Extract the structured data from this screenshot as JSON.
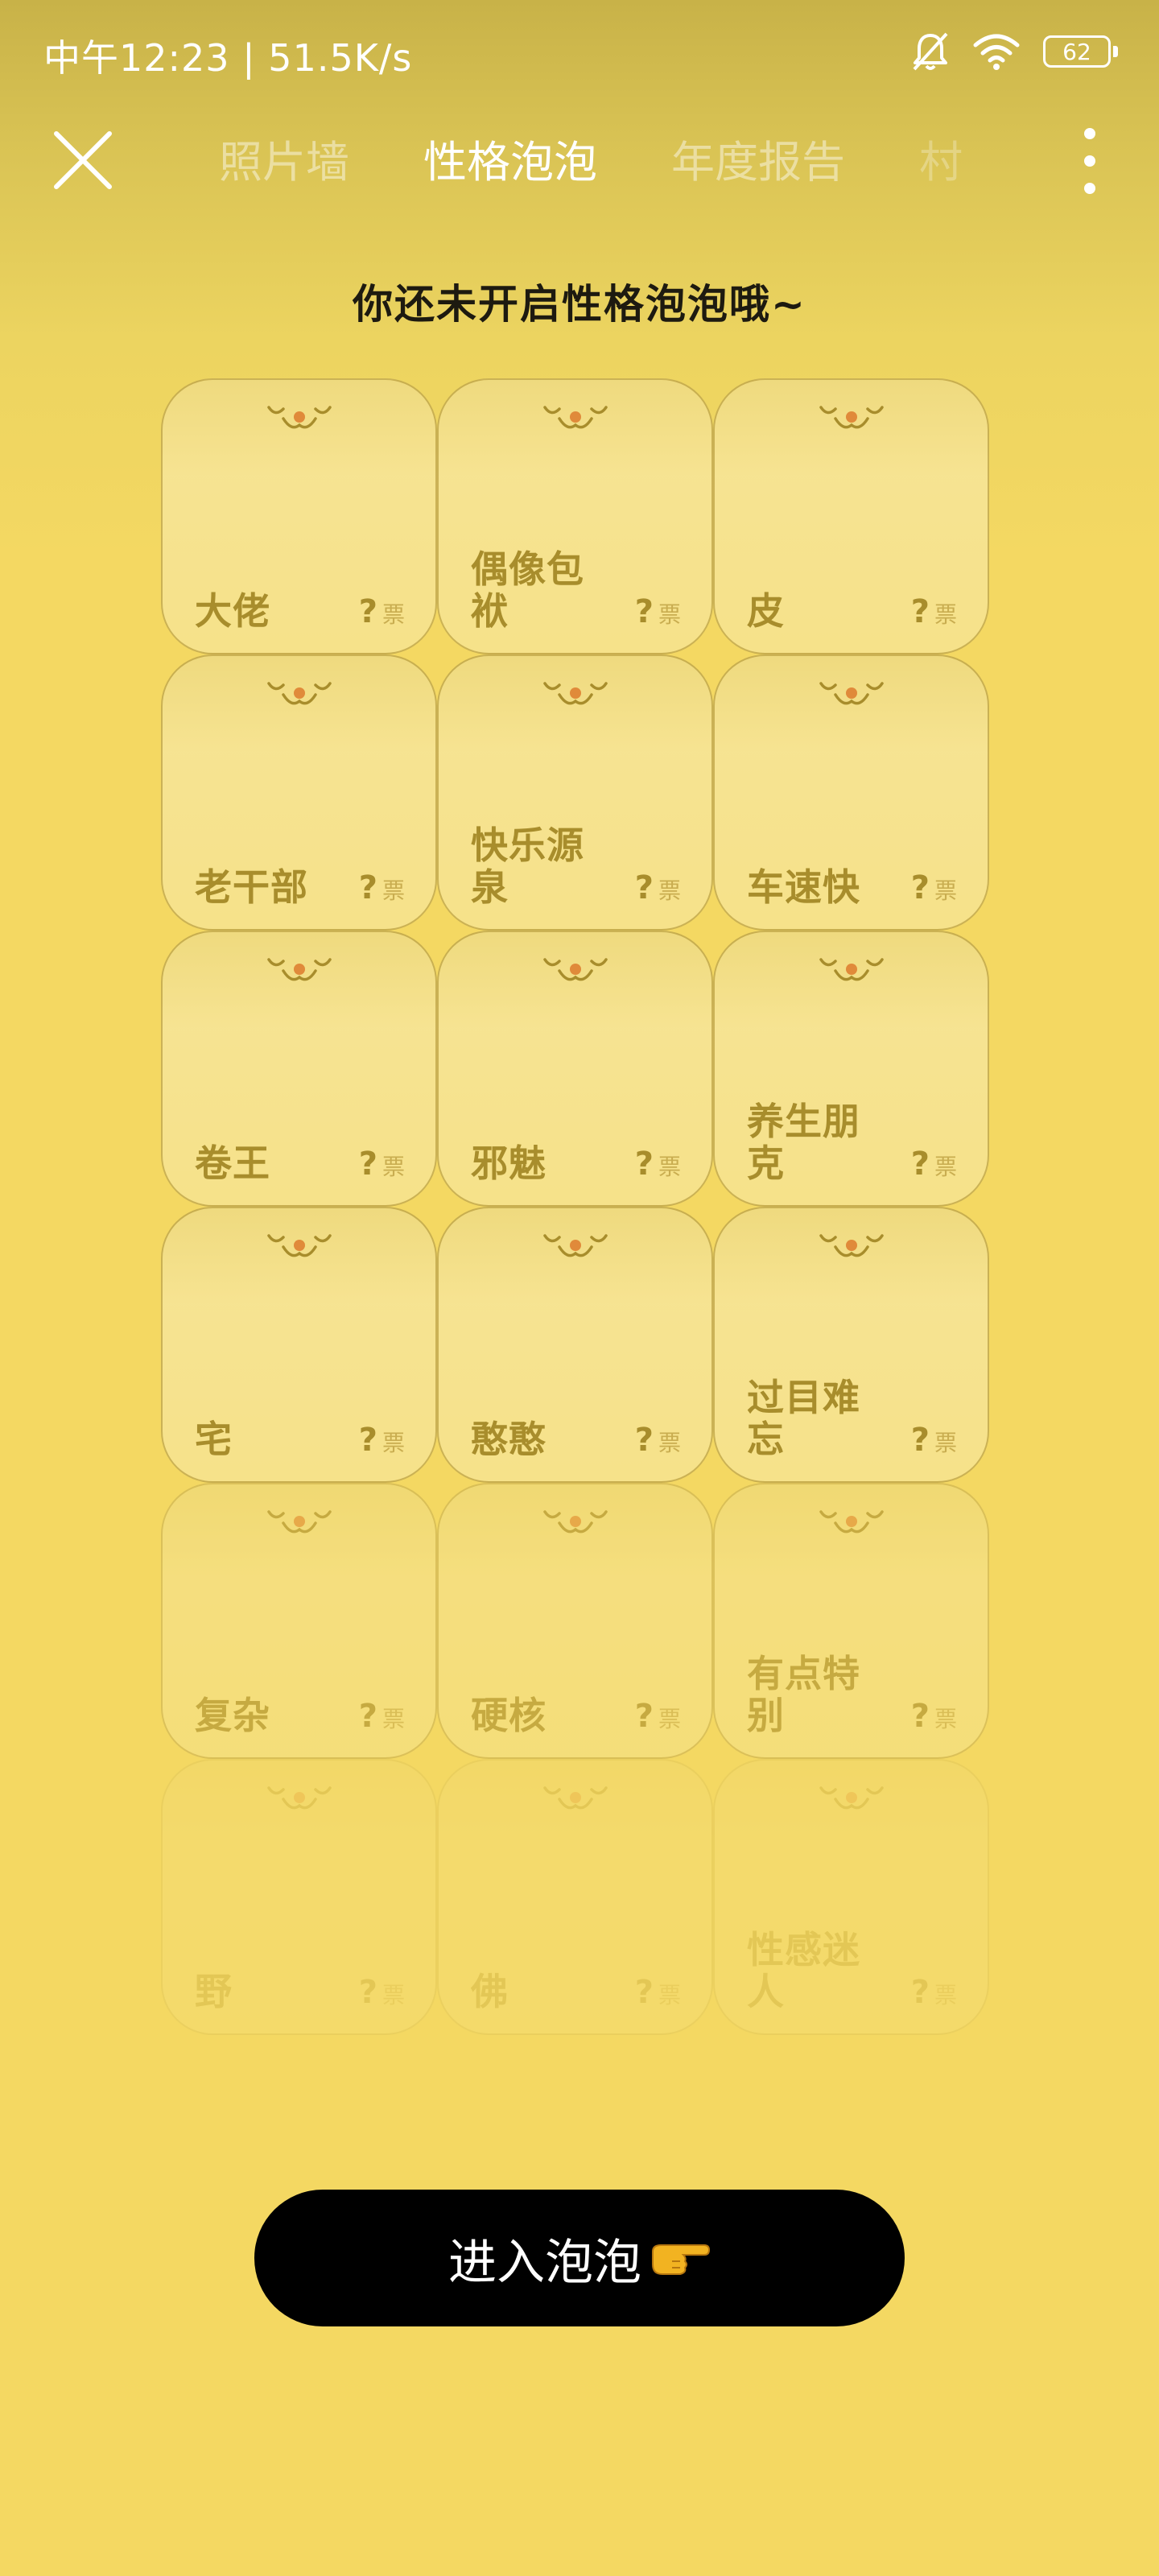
{
  "status_bar": {
    "text": "中午12:23 | 51.5K/s",
    "battery": "62"
  },
  "nav": {
    "tabs": [
      {
        "label": "照片墙"
      },
      {
        "label": "性格泡泡"
      },
      {
        "label": "年度报告"
      },
      {
        "label": "村"
      }
    ],
    "active_tab": 1
  },
  "headline": "你还未开启性格泡泡哦~",
  "vote_symbol": "?",
  "vote_unit": "票",
  "bubbles": [
    {
      "name": "大佬"
    },
    {
      "name": "偶像包袱"
    },
    {
      "name": "皮"
    },
    {
      "name": "老干部"
    },
    {
      "name": "快乐源泉"
    },
    {
      "name": "车速快"
    },
    {
      "name": "卷王"
    },
    {
      "name": "邪魅"
    },
    {
      "name": "养生朋克"
    },
    {
      "name": "宅"
    },
    {
      "name": "憨憨"
    },
    {
      "name": "过目难忘"
    },
    {
      "name": "复杂"
    },
    {
      "name": "硬核"
    },
    {
      "name": "有点特别"
    },
    {
      "name": "野"
    },
    {
      "name": "佛"
    },
    {
      "name": "性感迷人"
    }
  ],
  "enter_button": {
    "label": "进入泡泡"
  },
  "icons": {
    "close": "close-icon",
    "more": "more-vertical-icon",
    "face": "bubble-face-icon",
    "hand": "pointing-hand-icon",
    "bell_off": "bell-off-icon",
    "wifi": "wifi-icon",
    "battery": "battery-icon"
  },
  "colors": {
    "background": "#f4d862",
    "button": "#000000",
    "bubble_text": "#a88d2c",
    "bubble_face": "#e08a3a"
  }
}
